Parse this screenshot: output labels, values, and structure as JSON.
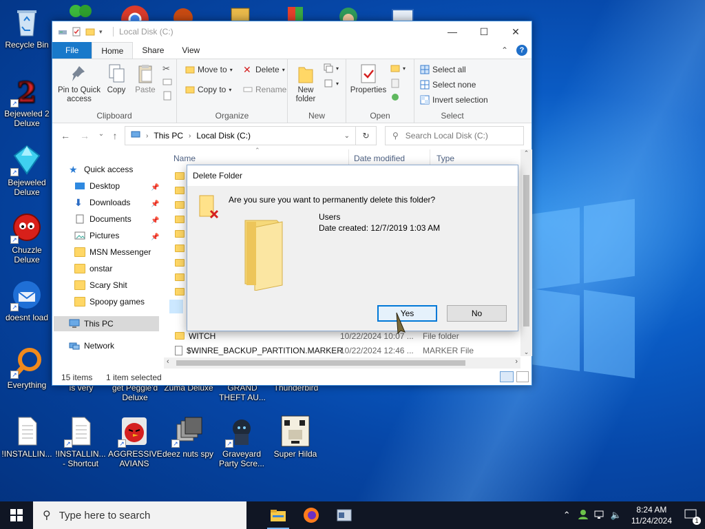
{
  "desktop": {
    "icons": [
      {
        "label": "Recycle Bin",
        "icon": "recycle-bin-icon"
      },
      {
        "label": "Bejeweled 2 Deluxe",
        "icon": "bejeweled2-icon"
      },
      {
        "label": "Bejeweled Deluxe",
        "icon": "bejeweled-icon"
      },
      {
        "label": "Chuzzle Deluxe",
        "icon": "chuzzle-icon"
      },
      {
        "label": "doesnt load",
        "icon": "thunderbird-icon"
      },
      {
        "label": "Everything",
        "icon": "everything-search-icon"
      },
      {
        "label": "is very",
        "icon": "shortcut-icon"
      },
      {
        "label": "get Peggle'd Deluxe",
        "icon": "peggle-icon"
      },
      {
        "label": "Zuma Deluxe",
        "icon": "zuma-icon"
      },
      {
        "label": "GRAND THEFT AU...",
        "icon": "gta-icon"
      },
      {
        "label": "Thunderbird",
        "icon": "thunderbird-icon"
      },
      {
        "label": "!INSTALLIN...",
        "icon": "text-file-icon"
      },
      {
        "label": "!INSTALLIN... - Shortcut",
        "icon": "text-file-shortcut-icon"
      },
      {
        "label": "AGGRESSIVE AVIANS",
        "icon": "angry-bird-icon"
      },
      {
        "label": "deez nuts spy",
        "icon": "stacked-windows-icon"
      },
      {
        "label": "Graveyard Party Scre...",
        "icon": "graveyard-icon"
      },
      {
        "label": "Super Hilda",
        "icon": "super-hilda-icon"
      }
    ]
  },
  "explorer": {
    "title": "Local Disk (C:)",
    "tabs": {
      "file": "File",
      "home": "Home",
      "share": "Share",
      "view": "View"
    },
    "ribbon": {
      "clipboard": {
        "pin": "Pin to Quick access",
        "copy": "Copy",
        "paste": "Paste",
        "label": "Clipboard"
      },
      "organize": {
        "move_to": "Move to",
        "copy_to": "Copy to",
        "delete": "Delete",
        "rename": "Rename",
        "label": "Organize"
      },
      "new": {
        "new_folder": "New folder",
        "label": "New"
      },
      "open": {
        "properties": "Properties",
        "label": "Open"
      },
      "select": {
        "select_all": "Select all",
        "select_none": "Select none",
        "invert": "Invert selection",
        "label": "Select"
      }
    },
    "address": {
      "this_pc": "This PC",
      "drive": "Local Disk (C:)"
    },
    "search_placeholder": "Search Local Disk (C:)",
    "nav": {
      "quick_access": "Quick access",
      "items": [
        "Desktop",
        "Downloads",
        "Documents",
        "Pictures",
        "MSN Messenger",
        "onstar",
        "Scary Shit",
        "Spoopy games"
      ],
      "this_pc": "This PC",
      "network": "Network"
    },
    "columns": {
      "name": "Name",
      "date": "Date modified",
      "type": "Type"
    },
    "rows": [
      {
        "name": "WITCH",
        "date": "10/22/2024 10:07 ...",
        "type": "File folder"
      },
      {
        "name": "$WINRE_BACKUP_PARTITION.MARKER",
        "date": "10/22/2024 12:46 ...",
        "type": "MARKER File"
      }
    ],
    "status": {
      "count": "15 items",
      "selected": "1 item selected"
    }
  },
  "dialog": {
    "title": "Delete Folder",
    "question": "Are you sure you want to permanently delete this folder?",
    "folder_name": "Users",
    "date_created": "Date created: 12/7/2019 1:03 AM",
    "yes": "Yes",
    "no": "No"
  },
  "taskbar": {
    "search_placeholder": "Type here to search",
    "time": "8:24 AM",
    "date": "11/24/2024",
    "notifications": "1"
  },
  "colors": {
    "accent": "#0078d7",
    "file_tab": "#1979ca",
    "taskbar": "#101624",
    "folder": "#ffd766"
  }
}
